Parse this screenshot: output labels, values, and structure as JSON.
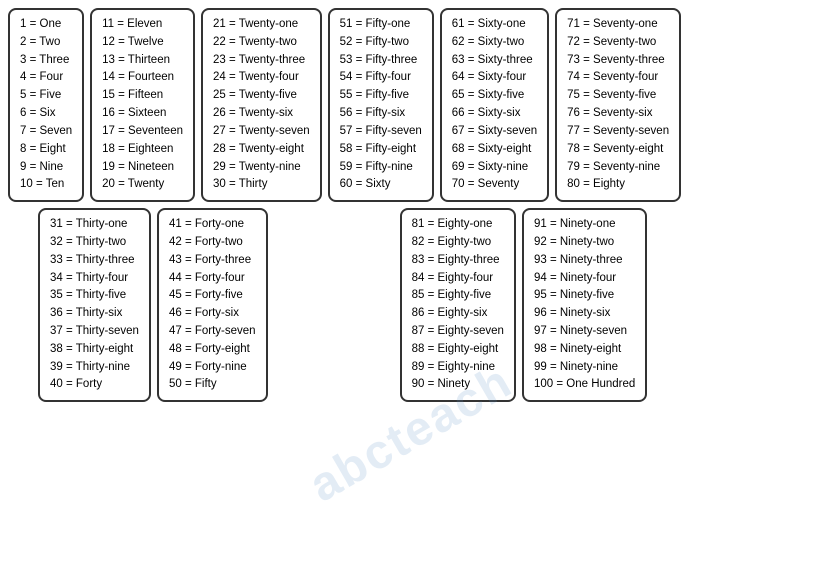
{
  "cards": [
    {
      "id": "card-1-10",
      "entries": [
        "1  =  One",
        "2  =  Two",
        "3  =  Three",
        "4  =  Four",
        "5  =  Five",
        "6  =  Six",
        "7  =  Seven",
        "8  =  Eight",
        "9  =  Nine",
        "10  =  Ten"
      ]
    },
    {
      "id": "card-11-20",
      "entries": [
        "11  =  Eleven",
        "12  =  Twelve",
        "13  =  Thirteen",
        "14  =  Fourteen",
        "15  =  Fifteen",
        "16  =  Sixteen",
        "17  =  Seventeen",
        "18  =  Eighteen",
        "19  =  Nineteen",
        "20  =  Twenty"
      ]
    },
    {
      "id": "card-21-30",
      "entries": [
        "21  =  Twenty-one",
        "22  =  Twenty-two",
        "23  =  Twenty-three",
        "24  =  Twenty-four",
        "25  =  Twenty-five",
        "26  =  Twenty-six",
        "27  =  Twenty-seven",
        "28  =  Twenty-eight",
        "29  =  Twenty-nine",
        "30  =  Thirty"
      ]
    },
    {
      "id": "card-51-60",
      "entries": [
        "51  =  Fifty-one",
        "52  =  Fifty-two",
        "53  =  Fifty-three",
        "54  =  Fifty-four",
        "55  =  Fifty-five",
        "56  =  Fifty-six",
        "57  =  Fifty-seven",
        "58  =  Fifty-eight",
        "59  =  Fifty-nine",
        "60  =  Sixty"
      ]
    },
    {
      "id": "card-61-70",
      "entries": [
        "61  =  Sixty-one",
        "62  =  Sixty-two",
        "63  =  Sixty-three",
        "64  =  Sixty-four",
        "65  =  Sixty-five",
        "66  =  Sixty-six",
        "67  =  Sixty-seven",
        "68  =  Sixty-eight",
        "69  =  Sixty-nine",
        "70  =  Seventy"
      ]
    },
    {
      "id": "card-71-80",
      "entries": [
        "71  =  Seventy-one",
        "72  =  Seventy-two",
        "73  =  Seventy-three",
        "74  =  Seventy-four",
        "75  =  Seventy-five",
        "76  =  Seventy-six",
        "77  =  Seventy-seven",
        "78  =  Seventy-eight",
        "79  =  Seventy-nine",
        "80  =  Eighty"
      ]
    },
    {
      "id": "card-31-40",
      "entries": [
        "31  =  Thirty-one",
        "32  =  Thirty-two",
        "33  =  Thirty-three",
        "34  =  Thirty-four",
        "35  =  Thirty-five",
        "36  =  Thirty-six",
        "37  =  Thirty-seven",
        "38  =  Thirty-eight",
        "39  =  Thirty-nine",
        "40  =  Forty"
      ]
    },
    {
      "id": "card-41-50",
      "entries": [
        "41  =  Forty-one",
        "42  =  Forty-two",
        "43  =  Forty-three",
        "44  =  Forty-four",
        "45  =  Forty-five",
        "46  =  Forty-six",
        "47  =  Forty-seven",
        "48  =  Forty-eight",
        "49  =  Forty-nine",
        "50  =  Fifty"
      ]
    },
    {
      "id": "card-81-90",
      "entries": [
        "81  =  Eighty-one",
        "82  =  Eighty-two",
        "83  =  Eighty-three",
        "84  =  Eighty-four",
        "85  =  Eighty-five",
        "86  =  Eighty-six",
        "87  =  Eighty-seven",
        "88  =  Eighty-eight",
        "89  =  Eighty-nine",
        "90  =  Ninety"
      ]
    },
    {
      "id": "card-91-100",
      "entries": [
        "91  =  Ninety-one",
        "92  =  Ninety-two",
        "93  =  Ninety-three",
        "94  =  Ninety-four",
        "95  =  Ninety-five",
        "96  =  Ninety-six",
        "97  =  Ninety-seven",
        "98  =  Ninety-eight",
        "99  =  Ninety-nine",
        "100  =  One Hundred"
      ]
    }
  ],
  "watermark": "abcteach"
}
